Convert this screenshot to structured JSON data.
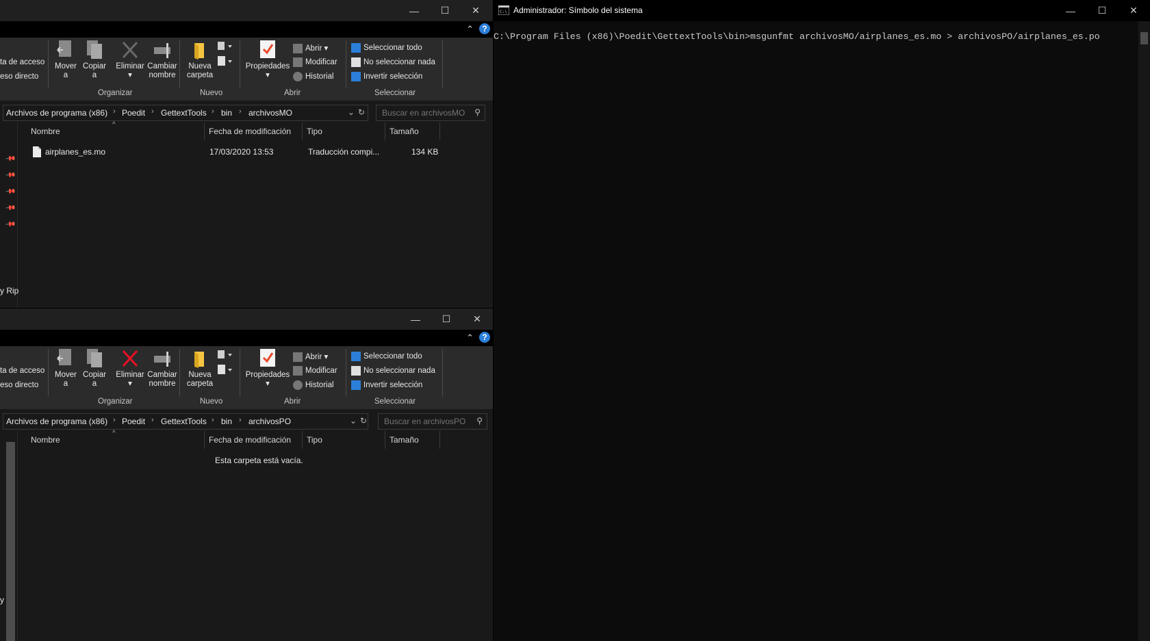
{
  "explorer_top": {
    "ribbon": {
      "left_cut_1": "ta de acceso",
      "left_cut_2": "eso directo",
      "mover": "Mover",
      "mover2": "a",
      "copiar": "Copiar",
      "copiar2": "a",
      "eliminar": "Eliminar",
      "cambiar": "Cambiar",
      "cambiar2": "nombre",
      "nueva": "Nueva",
      "nueva2": "carpeta",
      "propiedades": "Propiedades",
      "abrir": "Abrir",
      "modificar": "Modificar",
      "historial": "Historial",
      "sel_todo": "Seleccionar todo",
      "no_sel": "No seleccionar nada",
      "invertir": "Invertir selección",
      "grp_organizar": "Organizar",
      "grp_nuevo": "Nuevo",
      "grp_abrir": "Abrir",
      "grp_seleccionar": "Seleccionar"
    },
    "breadcrumb": [
      "Archivos de programa (x86)",
      "Poedit",
      "GettextTools",
      "bin",
      "archivosMO"
    ],
    "search_placeholder": "Buscar en archivosMO",
    "columns": {
      "name": "Nombre",
      "date": "Fecha de modificación",
      "type": "Tipo",
      "size": "Tamaño"
    },
    "files": [
      {
        "name": "airplanes_es.mo",
        "date": "17/03/2020 13:53",
        "type": "Traducción compi...",
        "size": "134 KB"
      }
    ],
    "nav_cut": "y Rip"
  },
  "explorer_bottom": {
    "ribbon": {
      "left_cut_1": "ta de acceso",
      "left_cut_2": "eso directo",
      "mover": "Mover",
      "mover2": "a",
      "copiar": "Copiar",
      "copiar2": "a",
      "eliminar": "Eliminar",
      "cambiar": "Cambiar",
      "cambiar2": "nombre",
      "nueva": "Nueva",
      "nueva2": "carpeta",
      "propiedades": "Propiedades",
      "abrir": "Abrir",
      "modificar": "Modificar",
      "historial": "Historial",
      "sel_todo": "Seleccionar todo",
      "no_sel": "No seleccionar nada",
      "invertir": "Invertir selección",
      "grp_organizar": "Organizar",
      "grp_nuevo": "Nuevo",
      "grp_abrir": "Abrir",
      "grp_seleccionar": "Seleccionar"
    },
    "breadcrumb": [
      "Archivos de programa (x86)",
      "Poedit",
      "GettextTools",
      "bin",
      "archivosPO"
    ],
    "search_placeholder": "Buscar en archivosPO",
    "columns": {
      "name": "Nombre",
      "date": "Fecha de modificación",
      "type": "Tipo",
      "size": "Tamaño"
    },
    "empty_message": "Esta carpeta está vacía.",
    "nav_cut": "y"
  },
  "cmd": {
    "title": "Administrador: Símbolo del sistema",
    "line": "C:\\Program Files (x86)\\Poedit\\GettextTools\\bin>msgunfmt archivosMO/airplanes_es.mo > archivosPO/airplanes_es.po"
  },
  "window_buttons": {
    "minimize": "—",
    "maximize": "☐",
    "close": "✕"
  },
  "colors": {
    "accent_blue": "#2b7fd9",
    "folder_yellow": "#f5c542",
    "delete_red": "#e81123"
  }
}
